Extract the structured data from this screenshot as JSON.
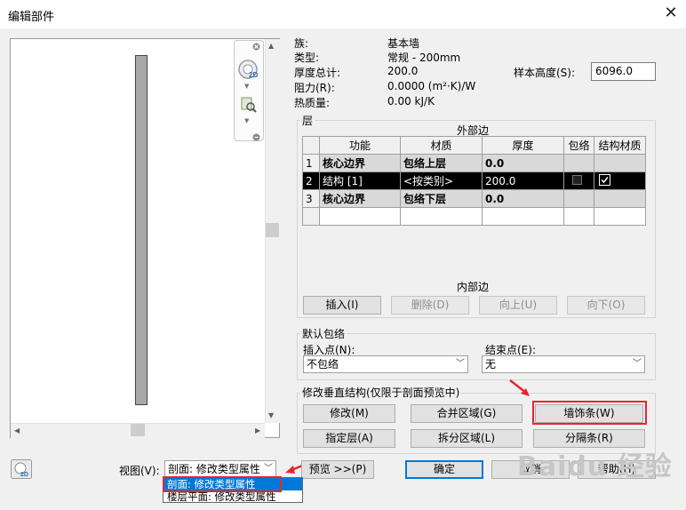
{
  "window": {
    "title": "编辑部件",
    "close_glyph": "✕"
  },
  "info": {
    "family_label": "族:",
    "family_value": "基本墙",
    "type_label": "类型:",
    "type_value": "常规 - 200mm",
    "thickness_label": "厚度总计:",
    "thickness_value": "200.0",
    "resistance_label": "阻力(R):",
    "resistance_value": "0.0000 (m²·K)/W",
    "thermal_label": "热质量:",
    "thermal_value": "0.00 kJ/K",
    "sample_height_label": "样本高度(S):",
    "sample_height_value": "6096.0"
  },
  "layers": {
    "group_label": "层",
    "exterior_label": "外部边",
    "interior_label": "内部边",
    "columns": [
      "",
      "功能",
      "材质",
      "厚度",
      "包络",
      "结构材质"
    ],
    "rows": [
      {
        "num": "1",
        "function": "核心边界",
        "material": "包络上层",
        "thickness": "0.0",
        "wrap": "",
        "structural": ""
      },
      {
        "num": "2",
        "function": "结构 [1]",
        "material": "<按类别>",
        "thickness": "200.0",
        "wrap": "checkbox-filled",
        "structural": "checked"
      },
      {
        "num": "3",
        "function": "核心边界",
        "material": "包络下层",
        "thickness": "0.0",
        "wrap": "",
        "structural": ""
      }
    ],
    "buttons": {
      "insert": "插入(I)",
      "delete": "删除(D)",
      "up": "向上(U)",
      "down": "向下(O)"
    }
  },
  "wrapping": {
    "group_label": "默认包络",
    "insert_point_label": "插入点(N):",
    "insert_point_value": "不包络",
    "end_point_label": "结束点(E):",
    "end_point_value": "无"
  },
  "vertical": {
    "group_label": "修改垂直结构(仅限于剖面预览中)",
    "modify": "修改(M)",
    "merge": "合并区域(G)",
    "sweeps": "墙饰条(W)",
    "assign": "指定层(A)",
    "split": "拆分区域(L)",
    "reveals": "分隔条(R)"
  },
  "footer": {
    "view_label": "视图(V):",
    "view_value": "剖面: 修改类型属性",
    "preview_button": "预览 >>(P)",
    "ok": "确定",
    "cancel": "取消",
    "help": "帮助(H)"
  },
  "view_options": [
    "剖面: 修改类型属性",
    "楼层平面: 修改类型属性"
  ],
  "watermark": "Baidu 经验",
  "icons": {
    "nav_close": "close-icon",
    "steering_wheel": "steering-wheel-icon",
    "zoom": "zoom-icon",
    "view_2d": "2d-view-icon",
    "dropdown": "chevron-down-icon",
    "pointer": "red-arrow-icon"
  }
}
